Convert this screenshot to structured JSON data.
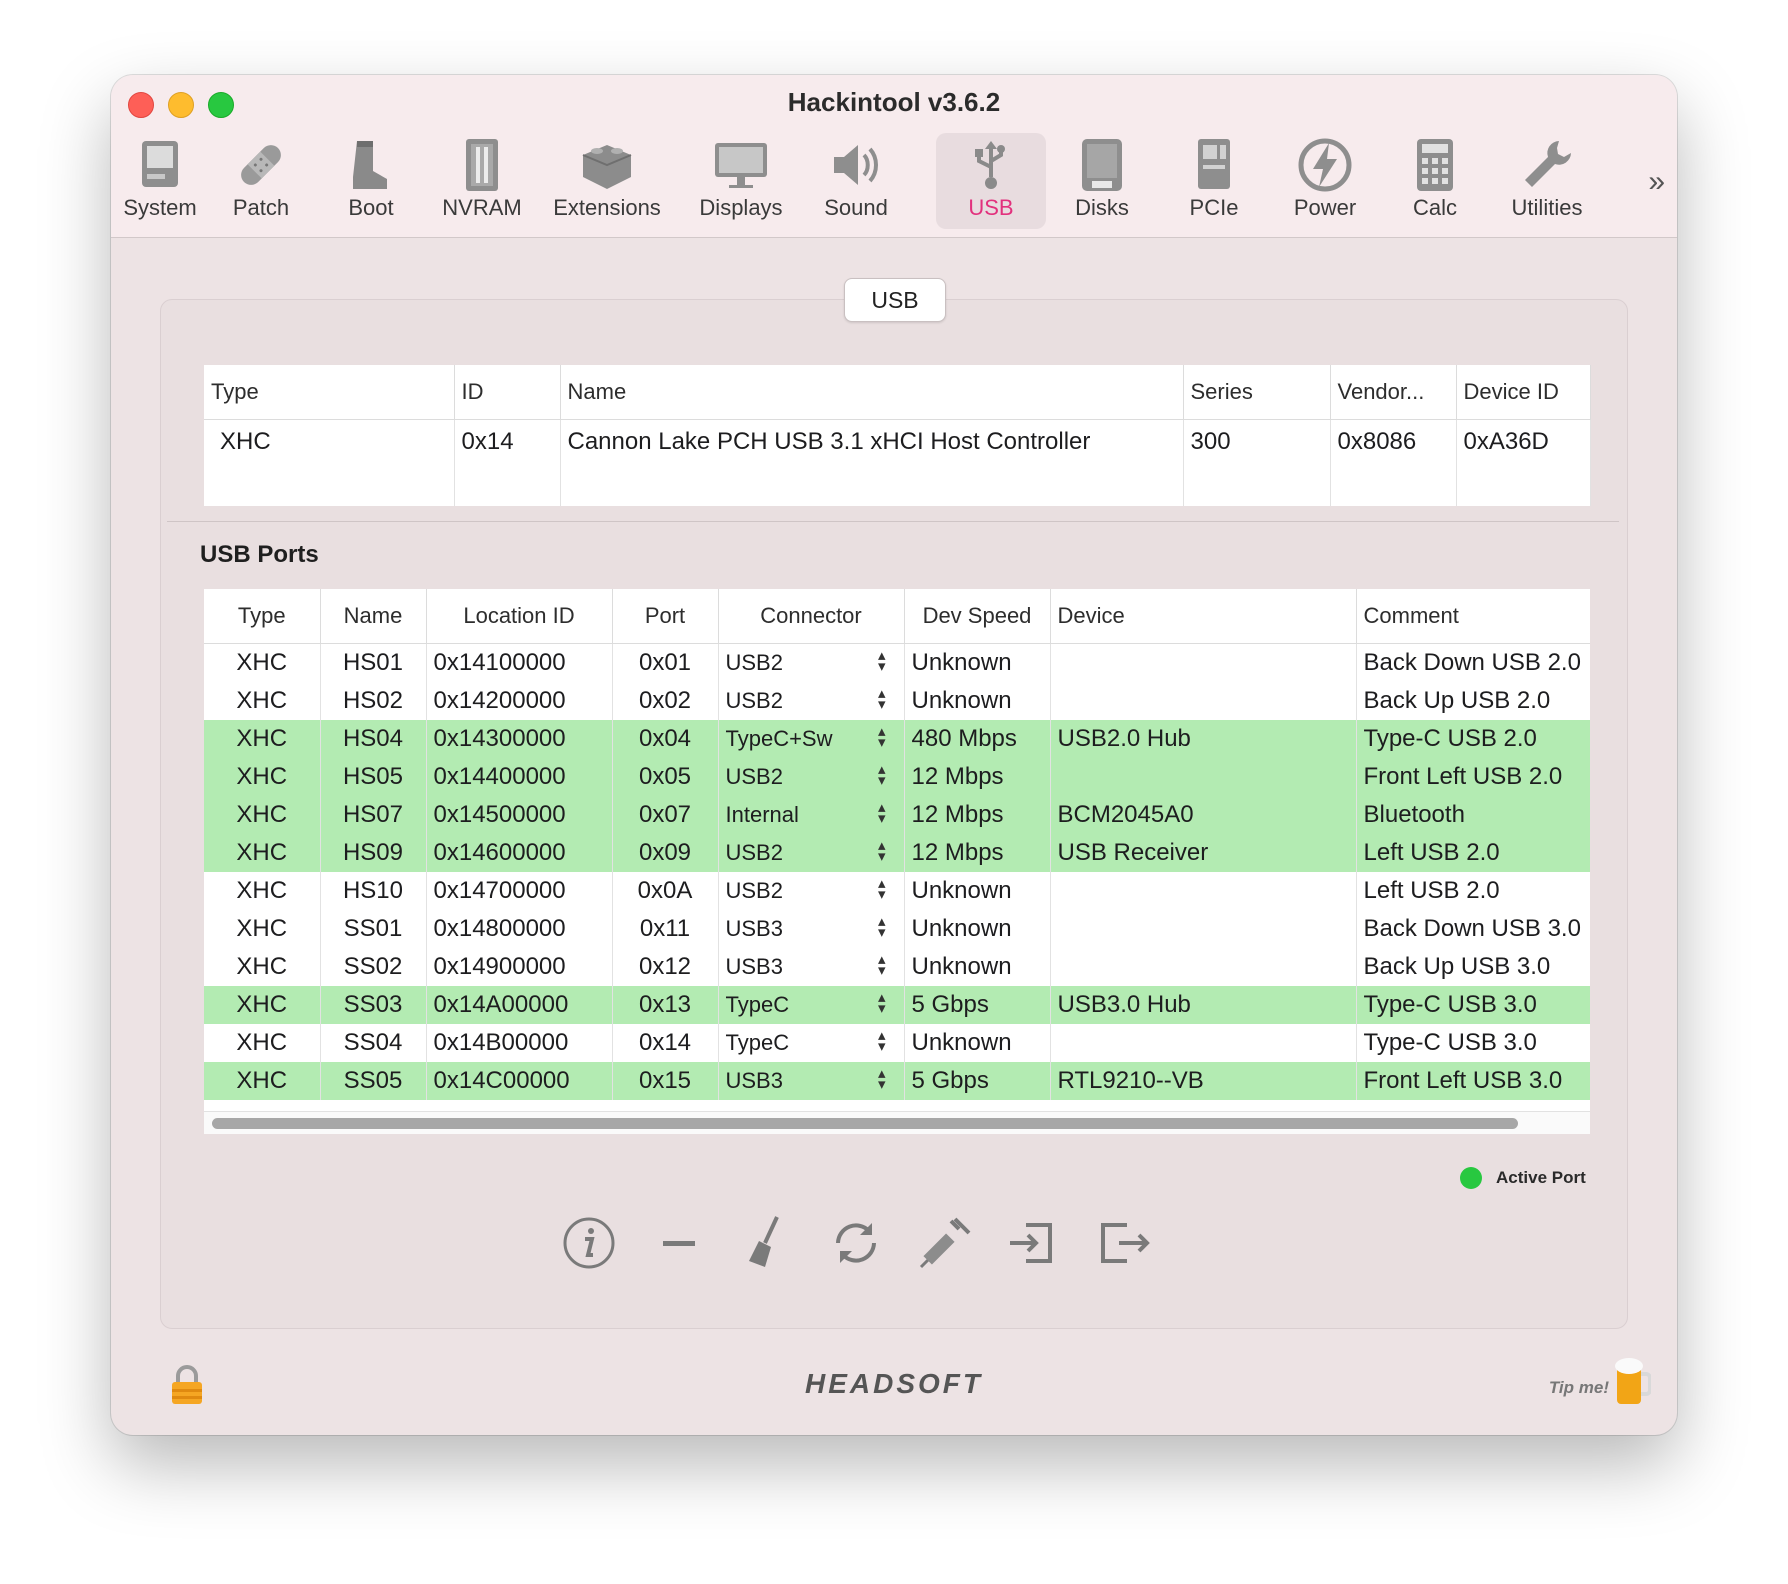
{
  "window": {
    "title": "Hackintool v3.6.2"
  },
  "toolbar": {
    "items": [
      {
        "label": "System",
        "icon": "computer-icon"
      },
      {
        "label": "Patch",
        "icon": "bandage-icon"
      },
      {
        "label": "Boot",
        "icon": "boot-icon"
      },
      {
        "label": "NVRAM",
        "icon": "memory-icon"
      },
      {
        "label": "Extensions",
        "icon": "lego-brick-icon"
      },
      {
        "label": "Displays",
        "icon": "display-icon"
      },
      {
        "label": "Sound",
        "icon": "speaker-icon"
      },
      {
        "label": "USB",
        "icon": "usb-icon"
      },
      {
        "label": "Disks",
        "icon": "disk-icon"
      },
      {
        "label": "PCIe",
        "icon": "pcie-card-icon"
      },
      {
        "label": "Power",
        "icon": "power-bolt-icon"
      },
      {
        "label": "Calc",
        "icon": "calculator-icon"
      },
      {
        "label": "Utilities",
        "icon": "wrench-icon"
      }
    ],
    "selected": "USB",
    "more": "»"
  },
  "tab": {
    "label": "USB"
  },
  "controller_table": {
    "columns": [
      "Type",
      "ID",
      "Name",
      "Series",
      "Vendor...",
      "Device ID"
    ],
    "rows": [
      [
        "XHC",
        "0x14",
        "Cannon Lake PCH USB 3.1 xHCI Host Controller",
        "300",
        "0x8086",
        "0xA36D"
      ]
    ]
  },
  "ports_section": {
    "label": "USB Ports"
  },
  "ports_table": {
    "columns": [
      "Type",
      "Name",
      "Location ID",
      "Port",
      "Connector",
      "Dev Speed",
      "Device",
      "Comment"
    ],
    "rows": [
      {
        "type": "XHC",
        "name": "HS01",
        "location": "0x14100000",
        "port": "0x01",
        "connector": "USB2",
        "speed": "Unknown",
        "device": "",
        "comment": "Back Down USB 2.0",
        "active": false
      },
      {
        "type": "XHC",
        "name": "HS02",
        "location": "0x14200000",
        "port": "0x02",
        "connector": "USB2",
        "speed": "Unknown",
        "device": "",
        "comment": "Back Up USB 2.0",
        "active": false
      },
      {
        "type": "XHC",
        "name": "HS04",
        "location": "0x14300000",
        "port": "0x04",
        "connector": "TypeC+Sw",
        "speed": "480 Mbps",
        "device": "USB2.0 Hub",
        "comment": "Type-C USB 2.0",
        "active": true
      },
      {
        "type": "XHC",
        "name": "HS05",
        "location": "0x14400000",
        "port": "0x05",
        "connector": "USB2",
        "speed": "12 Mbps",
        "device": "",
        "comment": "Front Left USB 2.0",
        "active": true
      },
      {
        "type": "XHC",
        "name": "HS07",
        "location": "0x14500000",
        "port": "0x07",
        "connector": "Internal",
        "speed": "12 Mbps",
        "device": "BCM2045A0",
        "comment": "Bluetooth",
        "active": true
      },
      {
        "type": "XHC",
        "name": "HS09",
        "location": "0x14600000",
        "port": "0x09",
        "connector": "USB2",
        "speed": "12 Mbps",
        "device": "USB Receiver",
        "comment": "Left USB 2.0",
        "active": true
      },
      {
        "type": "XHC",
        "name": "HS10",
        "location": "0x14700000",
        "port": "0x0A",
        "connector": "USB2",
        "speed": "Unknown",
        "device": "",
        "comment": "Left USB 2.0",
        "active": false
      },
      {
        "type": "XHC",
        "name": "SS01",
        "location": "0x14800000",
        "port": "0x11",
        "connector": "USB3",
        "speed": "Unknown",
        "device": "",
        "comment": "Back Down USB 3.0",
        "active": false
      },
      {
        "type": "XHC",
        "name": "SS02",
        "location": "0x14900000",
        "port": "0x12",
        "connector": "USB3",
        "speed": "Unknown",
        "device": "",
        "comment": "Back Up USB 3.0",
        "active": false
      },
      {
        "type": "XHC",
        "name": "SS03",
        "location": "0x14A00000",
        "port": "0x13",
        "connector": "TypeC",
        "speed": "5 Gbps",
        "device": "USB3.0 Hub",
        "comment": "Type-C USB 3.0",
        "active": true
      },
      {
        "type": "XHC",
        "name": "SS04",
        "location": "0x14B00000",
        "port": "0x14",
        "connector": "TypeC",
        "speed": "Unknown",
        "device": "",
        "comment": "Type-C USB 3.0",
        "active": false
      },
      {
        "type": "XHC",
        "name": "SS05",
        "location": "0x14C00000",
        "port": "0x15",
        "connector": "USB3",
        "speed": "5 Gbps",
        "device": "RTL9210--VB",
        "comment": "Front Left USB 3.0",
        "active": true
      }
    ]
  },
  "legend": {
    "label": "Active Port",
    "color": "#28c840"
  },
  "actions": [
    {
      "icon": "info-icon"
    },
    {
      "icon": "minus-icon"
    },
    {
      "icon": "broom-icon"
    },
    {
      "icon": "refresh-icon"
    },
    {
      "icon": "syringe-icon"
    },
    {
      "icon": "import-icon"
    },
    {
      "icon": "export-icon"
    }
  ],
  "footer": {
    "brand": "HEADSOFT",
    "tip": "Tip me!"
  },
  "colors": {
    "accent": "#e2317d",
    "active_row": "#b3ebb2"
  }
}
